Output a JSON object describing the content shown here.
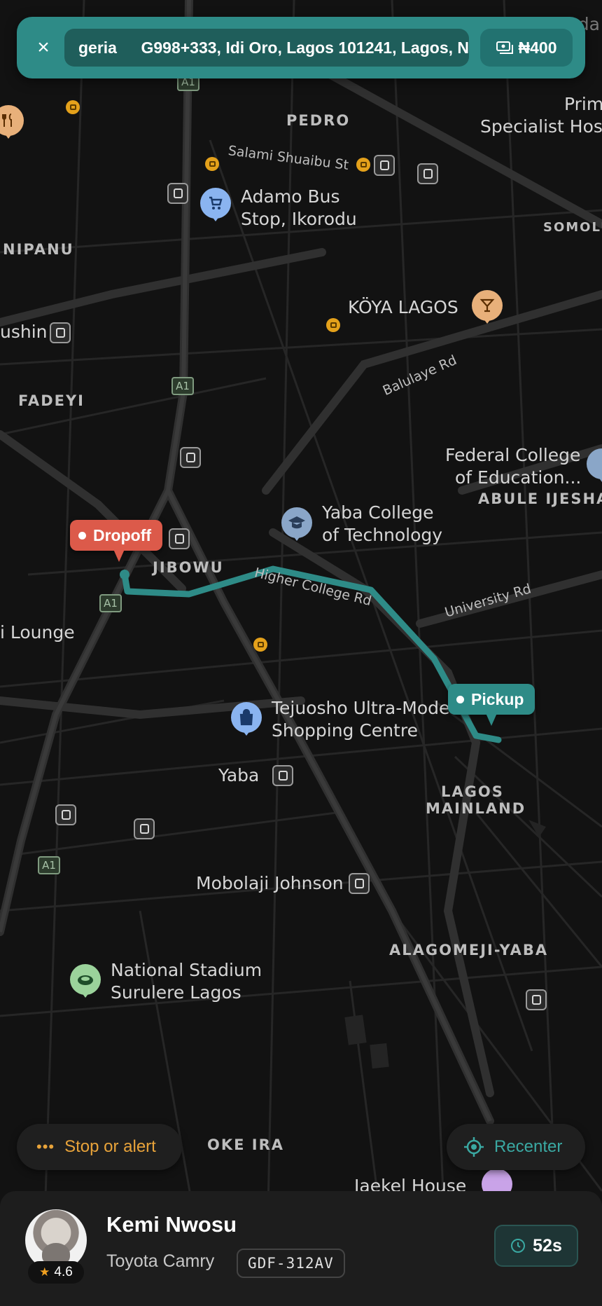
{
  "header": {
    "close_icon": "×",
    "route_from": "geria",
    "route_to": "G998+333, Idi Oro, Lagos 101241, Lagos, N",
    "fare": "₦400"
  },
  "map": {
    "districts": [
      "PEDRO",
      "NIPANU",
      "FADEYI",
      "JIBOWU",
      "ABULE IJESHA",
      "LAGOS",
      "MAINLAND",
      "ALAGOMEJI-YABA",
      "OKE IRA",
      "SOMOLU"
    ],
    "roads": [
      "Salami Shuaibu St",
      "Balulaye Rd",
      "Higher College Rd",
      "University Rd"
    ],
    "places": {
      "adamo": [
        "Adamo Bus",
        "Stop, Ikorodu"
      ],
      "koya": "KÖYA LAGOS",
      "federal": [
        "Federal College",
        "of Education..."
      ],
      "yaba_college": [
        "Yaba College",
        "of Technology"
      ],
      "tejuosho": [
        "Tejuosho Ultra-Mode",
        "Shopping Centre"
      ],
      "yaba": "Yaba",
      "mobolaji": "Mobolaji Johnson",
      "stadium": [
        "National Stadium",
        "Surulere Lagos"
      ],
      "lounge": "i Lounge",
      "ushin": "ushin",
      "prim": [
        "Prim",
        "Specialist Hos"
      ],
      "gbagada": "Gbagada",
      "jaekel": "Jaekel House"
    },
    "shield": "A1",
    "colors": {
      "route": "#2e8b87",
      "dropoff": "#dc5a4a",
      "pickup": "#2e8b87"
    }
  },
  "pins": {
    "dropoff": "Dropoff",
    "pickup": "Pickup"
  },
  "actions": {
    "stop_alert": "Stop or alert",
    "recenter": "Recenter"
  },
  "driver": {
    "name": "Kemi Nwosu",
    "rating": "4.6",
    "car": "Toyota Camry",
    "plate": "GDF-312AV",
    "eta": "52s"
  }
}
